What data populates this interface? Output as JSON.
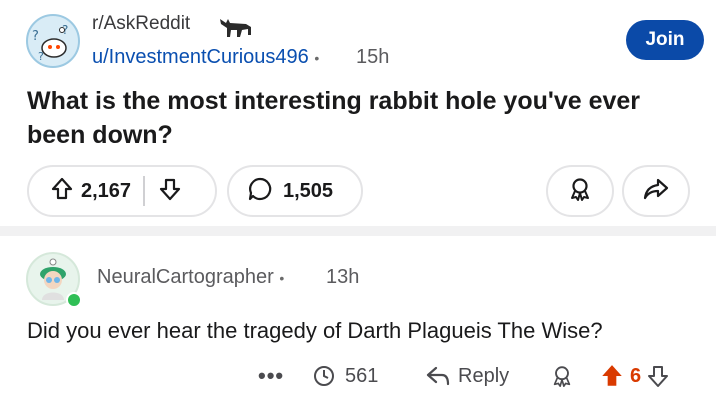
{
  "post": {
    "subreddit": "r/AskReddit",
    "author": "u/InvestmentCurious496",
    "separator": "•",
    "age": "15h",
    "join_label": "Join",
    "title": "What is the most interesting rabbit hole you've ever been down?",
    "upvotes": "2,167",
    "comments": "1,505"
  },
  "comment": {
    "author": "NeuralCartographer",
    "separator": "•",
    "age": "13h",
    "body": "Did you ever hear the tragedy of Darth Plagueis The Wise?",
    "more_label": "•••",
    "award_count": "561",
    "reply_label": "Reply",
    "score": "6",
    "score_color": "#d93a00"
  },
  "colors": {
    "join_bg": "#0b4aa8",
    "author_link": "#0a4fb0",
    "online": "#2fbf56"
  },
  "icons": [
    "subreddit-avatar-icon",
    "donkey-icon",
    "upvote-icon",
    "downvote-icon",
    "comment-icon",
    "award-icon",
    "share-icon",
    "more-icon",
    "reply-icon",
    "upvote-filled-icon"
  ]
}
